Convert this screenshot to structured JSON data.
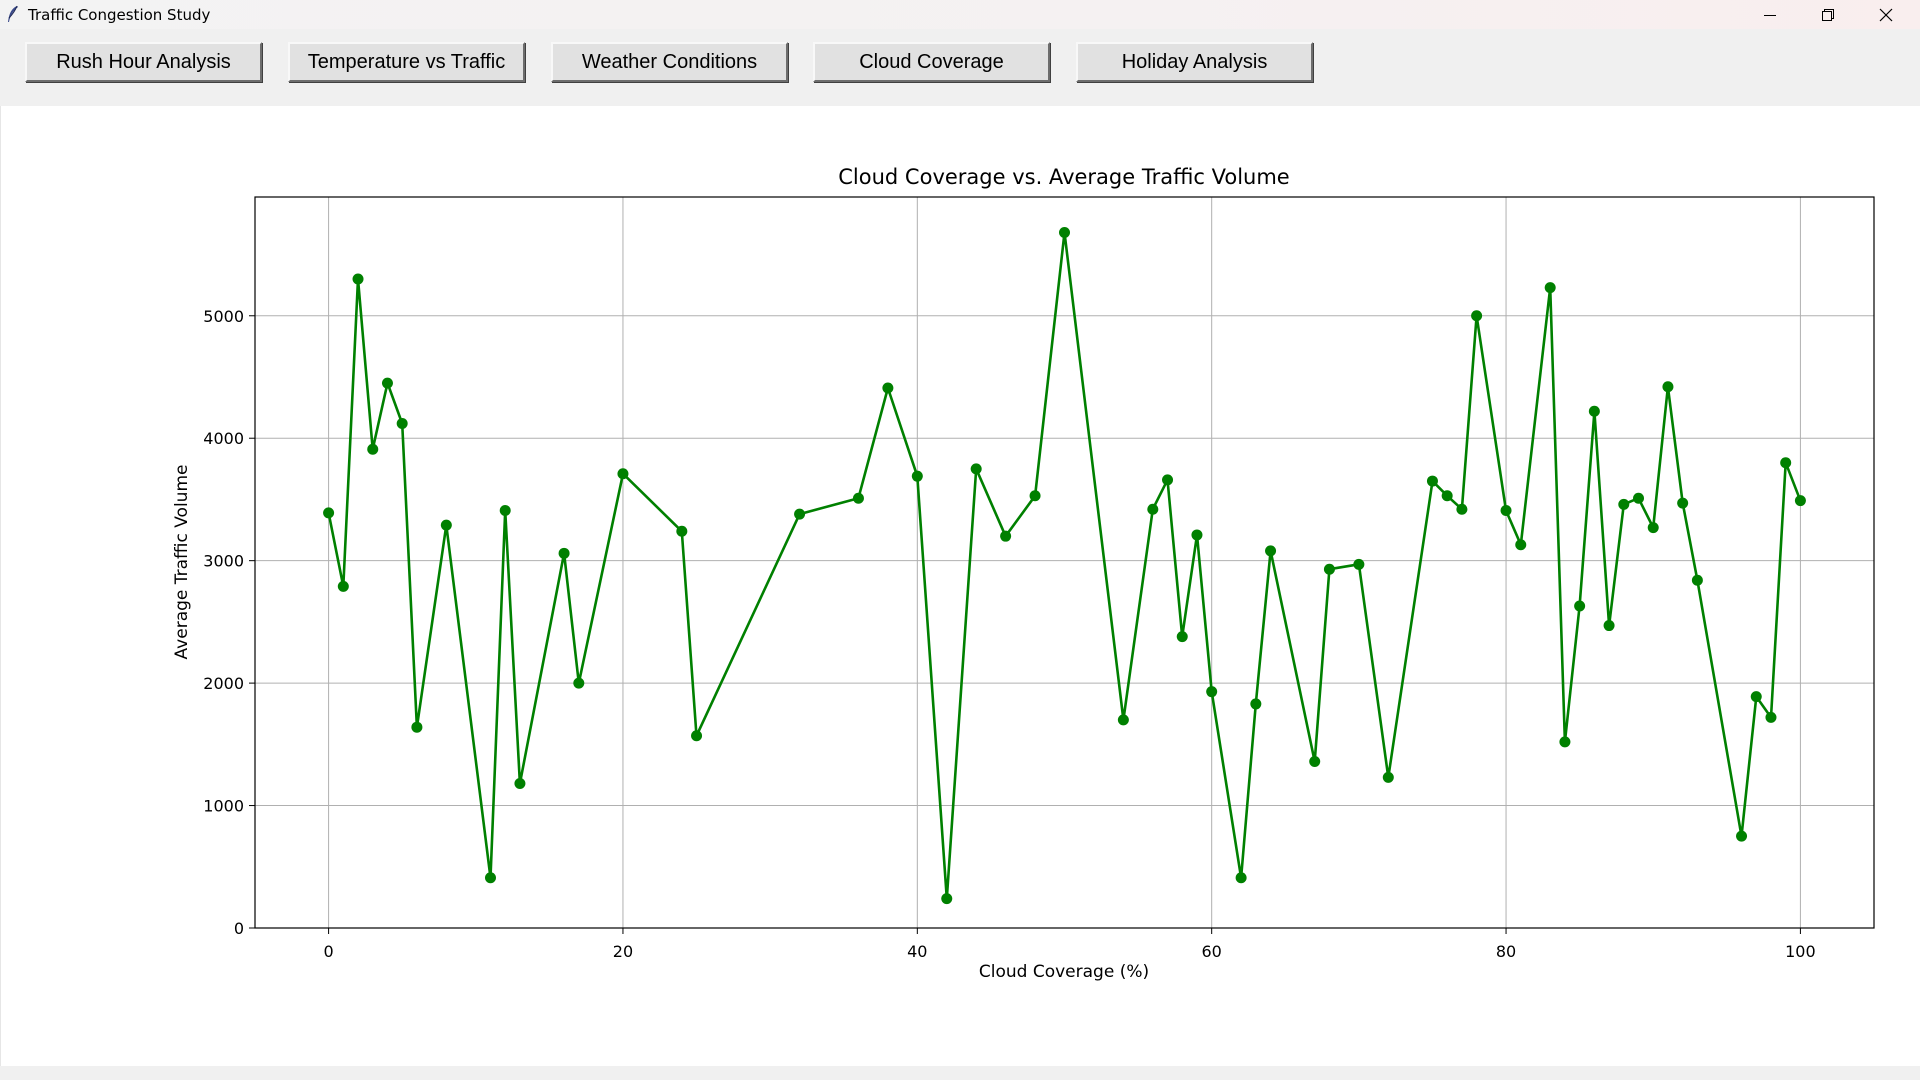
{
  "window": {
    "title": "Traffic Congestion Study",
    "icons": {
      "app": "feather-icon",
      "minimize": "minimize-icon",
      "maximize": "restore-icon",
      "close": "close-icon"
    }
  },
  "toolbar": {
    "buttons": [
      {
        "label": "Rush Hour Analysis"
      },
      {
        "label": "Temperature vs Traffic"
      },
      {
        "label": "Weather Conditions"
      },
      {
        "label": "Cloud Coverage"
      },
      {
        "label": "Holiday Analysis"
      }
    ]
  },
  "colors": {
    "series": "#008000",
    "grid": "#b0b0b0",
    "axis": "#000000"
  },
  "chart_data": {
    "type": "line",
    "title": "Cloud Coverage vs. Average Traffic Volume",
    "xlabel": "Cloud Coverage (%)",
    "ylabel": "Average Traffic Volume",
    "xlim": [
      -5,
      105
    ],
    "ylim": [
      0,
      5970
    ],
    "xticks": [
      0,
      20,
      40,
      60,
      80,
      100
    ],
    "yticks": [
      0,
      1000,
      2000,
      3000,
      4000,
      5000
    ],
    "grid": true,
    "marker": "circle",
    "series": [
      {
        "x": [
          0,
          1,
          2,
          3,
          4,
          5,
          6,
          8,
          11,
          12,
          13,
          16,
          17,
          20,
          24,
          25,
          32,
          36,
          38,
          40,
          42,
          44,
          46,
          48,
          50,
          54,
          56,
          57,
          58,
          59,
          60,
          62,
          63,
          64,
          67,
          68,
          70,
          72,
          75,
          76,
          77,
          78,
          80,
          81,
          83,
          84,
          85,
          86,
          87,
          88,
          89,
          90,
          91,
          92,
          93,
          96,
          97,
          98,
          99,
          100
        ],
        "y": [
          3390,
          2790,
          5300,
          3910,
          4450,
          4120,
          1640,
          3290,
          410,
          3410,
          1180,
          3060,
          2000,
          3710,
          3240,
          1570,
          3380,
          3510,
          4410,
          3690,
          240,
          3750,
          3200,
          3530,
          5680,
          1700,
          3420,
          3660,
          2380,
          3210,
          1930,
          410,
          1830,
          3080,
          1360,
          2930,
          2970,
          1230,
          3650,
          3530,
          3420,
          5000,
          3410,
          3130,
          5230,
          1520,
          2630,
          4220,
          2470,
          3460,
          3510,
          3270,
          4420,
          3470,
          2840,
          750,
          1890,
          1720,
          3800,
          3490
        ]
      }
    ]
  }
}
